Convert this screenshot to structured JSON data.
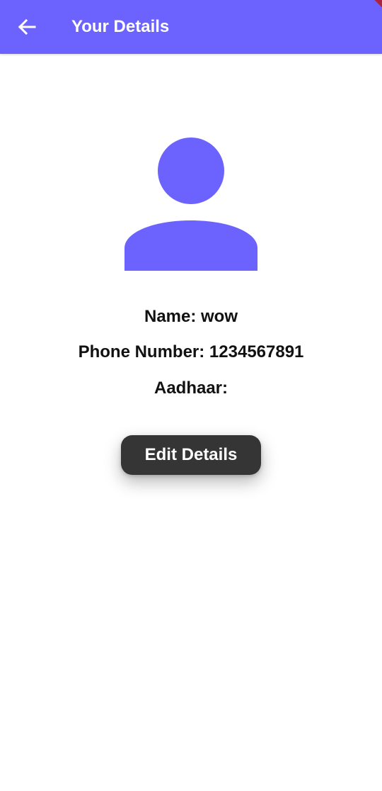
{
  "app_bar": {
    "title": "Your Details",
    "back_icon": "arrow-left-icon",
    "background_color": "#6c63ff",
    "title_color": "#ffffff"
  },
  "profile": {
    "avatar_icon": "person-icon",
    "avatar_color": "#6c63ff",
    "name_line": "Name: wow",
    "phone_line": "Phone Number: 1234567891",
    "aadhaar_line": "Aadhaar:"
  },
  "actions": {
    "edit_label": "Edit Details",
    "edit_button_color": "#353535"
  }
}
